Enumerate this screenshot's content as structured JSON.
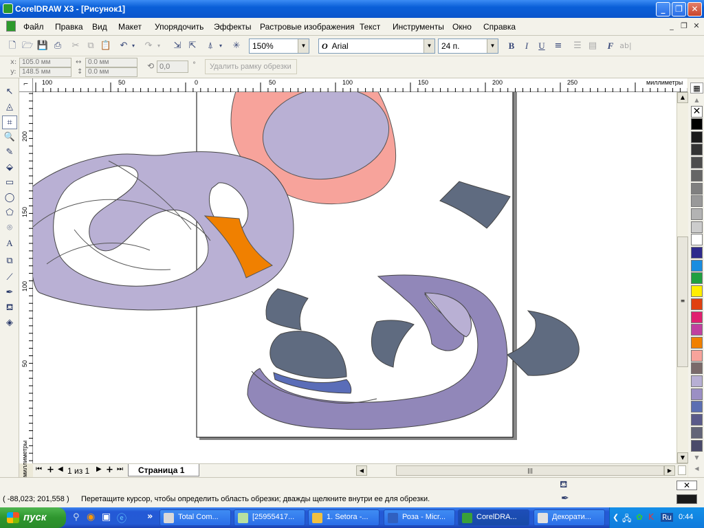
{
  "window": {
    "title": "CorelDRAW X3 - [Рисунок1]",
    "min": "_",
    "max": "❐",
    "close": "✕"
  },
  "menu": [
    "Файл",
    "Правка",
    "Вид",
    "Макет",
    "Упорядочить",
    "Эффекты",
    "Растровые изображения",
    "Текст",
    "Инструменты",
    "Окно",
    "Справка"
  ],
  "doc_controls": {
    "min": "_",
    "restore": "❐",
    "close": "✕"
  },
  "toolbar": {
    "zoom": "150%",
    "font": "Arial",
    "font_size": "24 п."
  },
  "propbar": {
    "x_label": "x:",
    "x_value": "105.0 мм",
    "y_label": "y:",
    "y_value": "148.5 мм",
    "w_value": "0.0 мм",
    "h_value": "0.0 мм",
    "angle": "0,0",
    "degree": "°",
    "delete_frame": "Удалить рамку обрезки"
  },
  "ruler": {
    "h_labels": [
      "100",
      "50",
      "0",
      "50",
      "100",
      "150",
      "200",
      "250"
    ],
    "h_unit": "миллиметры",
    "v_labels": [
      "200",
      "150",
      "100",
      "50"
    ],
    "v_unit": "миллиметры"
  },
  "pagebar": {
    "page_count": "1 из 1",
    "page_tab": "Страница 1"
  },
  "status": {
    "coords": "( -88,023; 201,558 )",
    "hint": "Перетащите курсор, чтобы определить область обрезки; дважды щелкните внутри ее для обрезки."
  },
  "taskbar": {
    "start": "пуск",
    "more": "»",
    "tasks": [
      "Total Com...",
      "[25955417...",
      "1. Setora -...",
      "Роза - Micr...",
      "CorelDRA...",
      "Декорати..."
    ],
    "lang": "Ru",
    "clock": "0:44",
    "task_colors": [
      "#d8d8d8",
      "#b8e0a0",
      "#f0c040",
      "#3060c0",
      "#3aa03a",
      "#e0e0e0"
    ]
  },
  "palette": [
    "#000000",
    "#1a1a1a",
    "#333333",
    "#4d4d4d",
    "#666666",
    "#808080",
    "#999999",
    "#b3b3b3",
    "#cccccc",
    "#ffffff",
    "#2e2a8c",
    "#1a8de0",
    "#20a040",
    "#ffee00",
    "#e04010",
    "#e02070",
    "#c040a0",
    "#f08000",
    "#f7a39b",
    "#7a6a6a",
    "#b7afd4",
    "#9b8fc4",
    "#5c6fb2",
    "#5a5a8a",
    "#626478",
    "#4a4a6a"
  ],
  "colors": {
    "lavender": "#b9b0d4",
    "salmon": "#f7a39b",
    "slate": "#5f6b80",
    "purple": "#9187b9",
    "orange": "#f08000",
    "blue": "#5a6db8"
  }
}
